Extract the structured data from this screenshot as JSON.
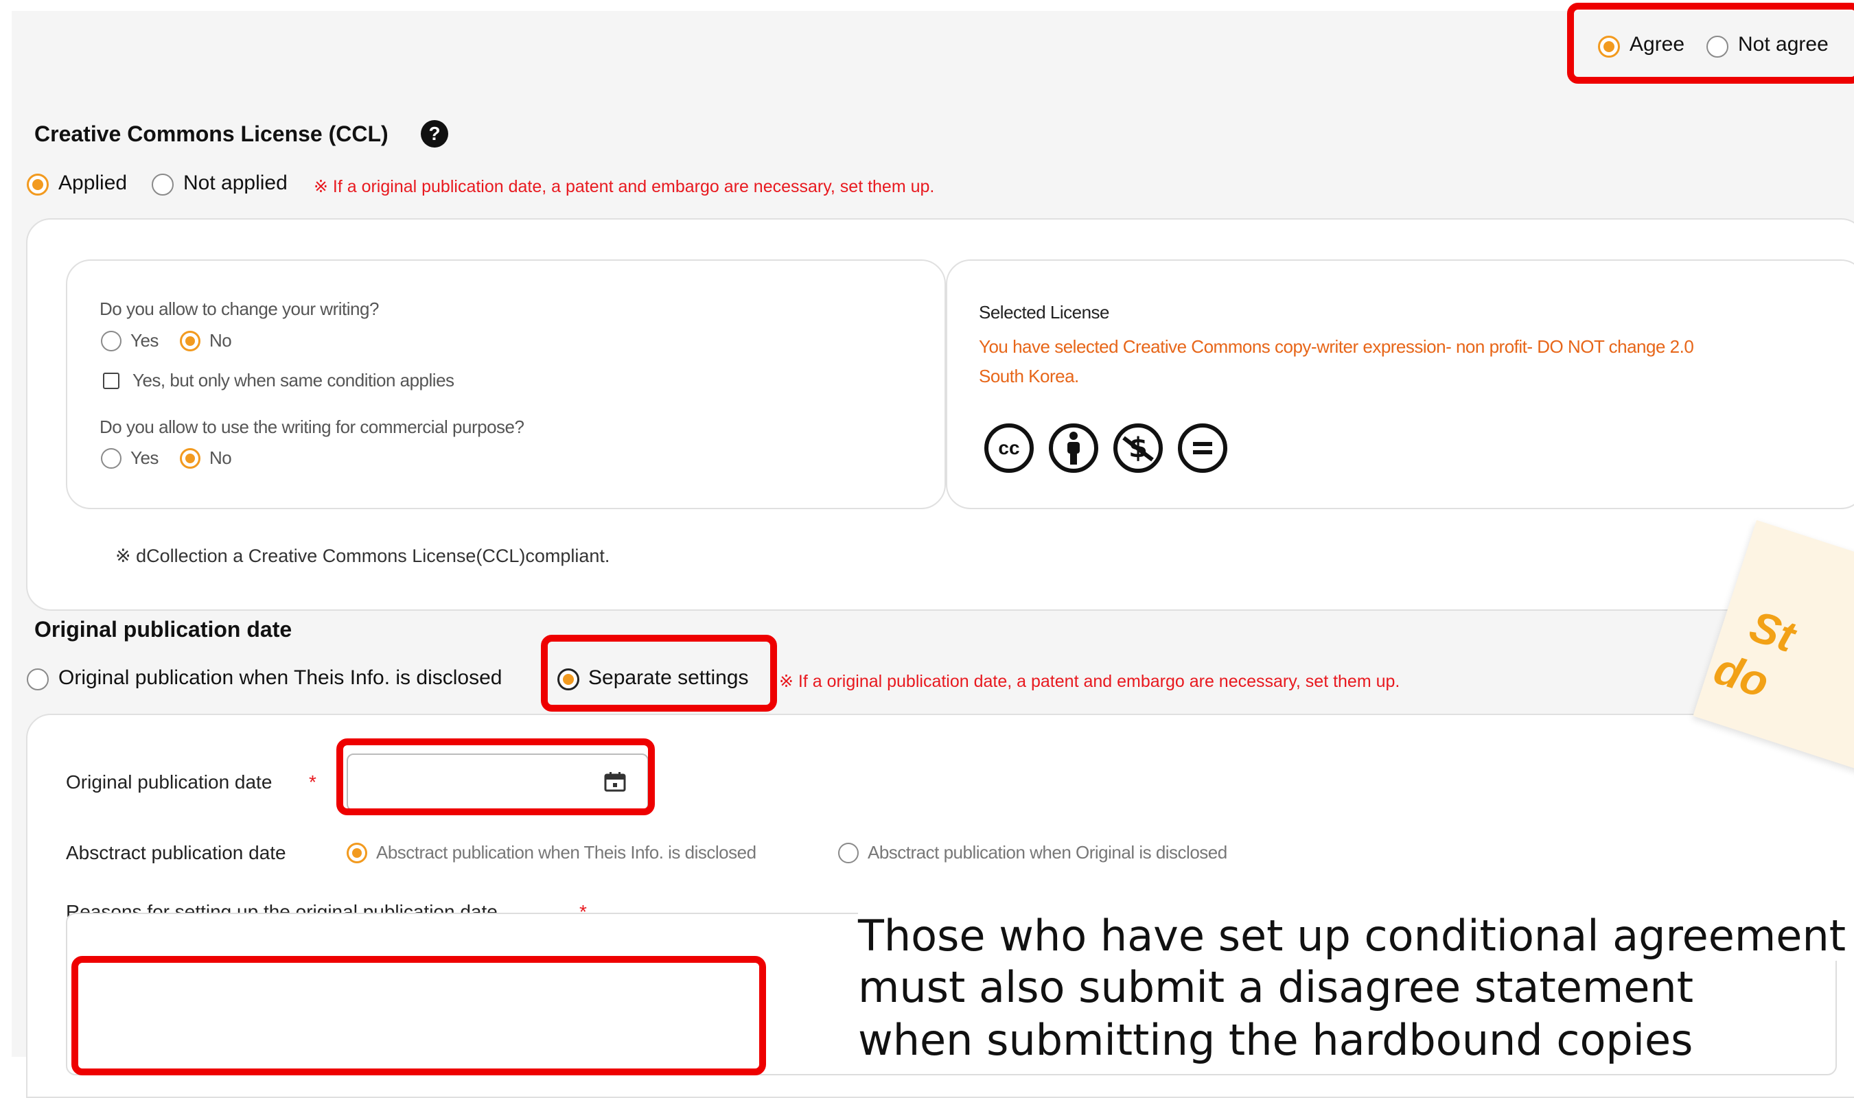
{
  "agreement": {
    "agree_label": "Agree",
    "not_agree_label": "Not agree",
    "selected": "Agree"
  },
  "ccl": {
    "title": "Creative Commons License (CCL)",
    "applied_label": "Applied",
    "not_applied_label": "Not applied",
    "selected": "Applied",
    "notice": "※ If a original publication date, a patent and embargo are necessary, set them up.",
    "questions": {
      "change_question": "Do you allow to change your writing?",
      "yes_label": "Yes",
      "no_label": "No",
      "same_condition_label": "Yes, but only when same condition applies",
      "commercial_question": "Do you allow to use the writing for commercial purpose?"
    },
    "selected_license": {
      "title": "Selected License",
      "description_line1": "You have selected Creative Commons copy-writer expression- non profit- DO NOT change 2.0",
      "description_line2": "South Korea.",
      "icons": [
        "cc-icon",
        "by-icon",
        "nc-icon",
        "nd-icon"
      ]
    },
    "compliance_note": "※ dCollection a Creative Commons License(CCL)compliant."
  },
  "original_publication": {
    "title": "Original publication date",
    "option_disclosed": "Original publication when Theis Info. is disclosed",
    "option_separate": "Separate settings",
    "selected": "Separate settings",
    "notice": "※ If a original publication date, a patent and embargo are necessary, set them up.",
    "date_label": "Original publication date",
    "required_mark": "*",
    "date_value": "",
    "abstract_label": "Absctract publication date",
    "abstract_option1": "Absctract publication when Theis Info. is disclosed",
    "abstract_option2": "Absctract publication when Original is disclosed",
    "reasons_label": "Reasons for setting up the original publication date.",
    "reasons_value": ""
  },
  "annotation": {
    "note_line1": "St",
    "note_line2": "do",
    "caption_line1": "Those who have set up conditional agreement an",
    "caption_line2": "must also submit a disagree statement",
    "caption_line3": "when submitting the hardbound copies"
  },
  "colors": {
    "accent": "#f29a1f",
    "required": "#e8191f",
    "license_text": "#e76619",
    "highlight": "#ee0000"
  }
}
